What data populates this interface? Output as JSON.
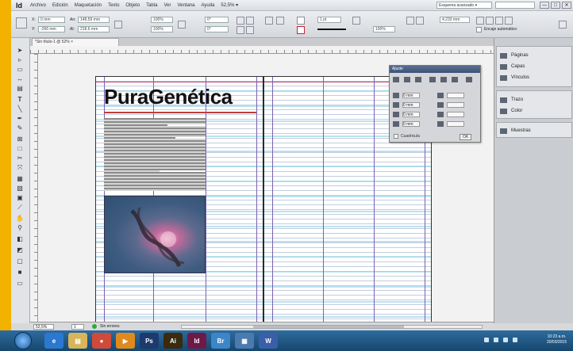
{
  "app": {
    "logo": "Id",
    "menus": [
      "Archivo",
      "Edición",
      "Maquetación",
      "Texto",
      "Objeto",
      "Tabla",
      "Ver",
      "Ventana",
      "Ayuda"
    ],
    "workspace": "Esquema avanzado ▾",
    "zoom": "52,5% ▾",
    "window_buttons": [
      "—",
      "□",
      "✕"
    ]
  },
  "control": {
    "x_label": "X:",
    "x_value": "0 mm",
    "y_label": "Y:",
    "y_value": "-266 mm",
    "w_label": "An:",
    "w_value": "148,59 mm",
    "h_label": "Al:",
    "h_value": "218,6 mm",
    "scale_x": "100%",
    "scale_y": "100%",
    "angle": "0°",
    "shear": "0°",
    "stroke_weight": "1 pt",
    "opacity": "100%",
    "ref_width": "4,233 mm",
    "autofit_label": "Encaje automático"
  },
  "document": {
    "tab_title": "*Sin título-1 @ 52%  ×"
  },
  "headline": {
    "word1": "Pura",
    "word2": "Genética",
    "color_accent": "#c23b3b"
  },
  "floating_panel": {
    "title": "Ajuste",
    "rows": [
      "0 mm",
      "0 mm",
      "0 mm",
      "0 mm"
    ],
    "checkbox_label": "Cuadricula",
    "ok_label": "OK"
  },
  "dock": {
    "group1": [
      {
        "icon": "pages-icon",
        "label": "Páginas"
      },
      {
        "icon": "layers-icon",
        "label": "Capas"
      },
      {
        "icon": "links-icon",
        "label": "Vínculos"
      }
    ],
    "group2": [
      {
        "icon": "stroke-icon",
        "label": "Trazo"
      },
      {
        "icon": "color-icon",
        "label": "Color"
      }
    ],
    "group3": [
      {
        "icon": "swatches-icon",
        "label": "Muestras"
      }
    ]
  },
  "status": {
    "zoom": "52,5%",
    "page": "1",
    "preflight": "Sin errores"
  },
  "taskbar": {
    "apps": [
      {
        "icon": "ie-icon",
        "label": "e",
        "color": "#2b78d0"
      },
      {
        "icon": "folder-icon",
        "label": "▤",
        "color": "#d8b45a"
      },
      {
        "icon": "chrome-icon",
        "label": "●",
        "color": "#d04a3a"
      },
      {
        "icon": "media-icon",
        "label": "▶",
        "color": "#e08a1e"
      },
      {
        "icon": "photoshop-icon",
        "label": "Ps",
        "color": "#1c3a6e"
      },
      {
        "icon": "illustrator-icon",
        "label": "Ai",
        "color": "#3a2a0e"
      },
      {
        "icon": "indesign-icon",
        "label": "Id",
        "color": "#6e1a48"
      },
      {
        "icon": "bridge-icon",
        "label": "Br",
        "color": "#3a86c8"
      },
      {
        "icon": "folder2-icon",
        "label": "▦",
        "color": "#4a7ab0"
      },
      {
        "icon": "word-icon",
        "label": "W",
        "color": "#3a5ea8"
      }
    ],
    "time": "10:23 a.m.",
    "date": "20/03/2015"
  }
}
